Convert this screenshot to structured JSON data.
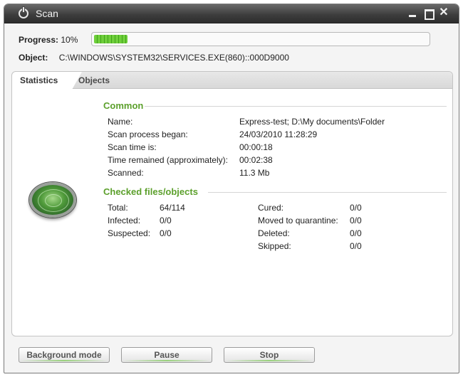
{
  "window": {
    "title": "Scan"
  },
  "progress": {
    "label": "Progress:",
    "percent_text": "10%",
    "fraction": 0.1
  },
  "object": {
    "label": "Object:",
    "value": "C:\\WINDOWS\\SYSTEM32\\SERVICES.EXE(860)::000D9000"
  },
  "tabs": [
    {
      "label": "Statistics",
      "active": true
    },
    {
      "label": "Objects",
      "active": false
    }
  ],
  "common": {
    "heading": "Common",
    "rows": [
      {
        "label": "Name:",
        "value": "Express-test; D:\\My documents\\Folder"
      },
      {
        "label": "Scan process began:",
        "value": "24/03/2010 11:28:29"
      },
      {
        "label": "Scan time is:",
        "value": "00:00:18"
      },
      {
        "label": "Time remained (approximately):",
        "value": "00:02:38"
      },
      {
        "label": "Scanned:",
        "value": "11.3 Mb"
      }
    ]
  },
  "checked": {
    "heading": "Checked files/objects",
    "left": [
      {
        "label": "Total:",
        "value": "64/114"
      },
      {
        "label": "Infected:",
        "value": "0/0"
      },
      {
        "label": "Suspected:",
        "value": "0/0"
      }
    ],
    "right": [
      {
        "label": "Cured:",
        "value": "0/0"
      },
      {
        "label": "Moved to quarantine:",
        "value": "0/0"
      },
      {
        "label": "Deleted:",
        "value": "0/0"
      },
      {
        "label": "Skipped:",
        "value": "0/0"
      }
    ]
  },
  "buttons": {
    "background_mode": "Background mode",
    "pause": "Pause",
    "stop": "Stop"
  },
  "icons": {
    "app": "power-icon",
    "minimize": "minimize-icon",
    "maximize": "maximize-icon",
    "close": "close-icon",
    "radar": "radar-icon"
  },
  "colors": {
    "accent_green": "#5ca02c",
    "progress_green": "#6fcf3b",
    "titlebar": "#3e3e3e"
  }
}
